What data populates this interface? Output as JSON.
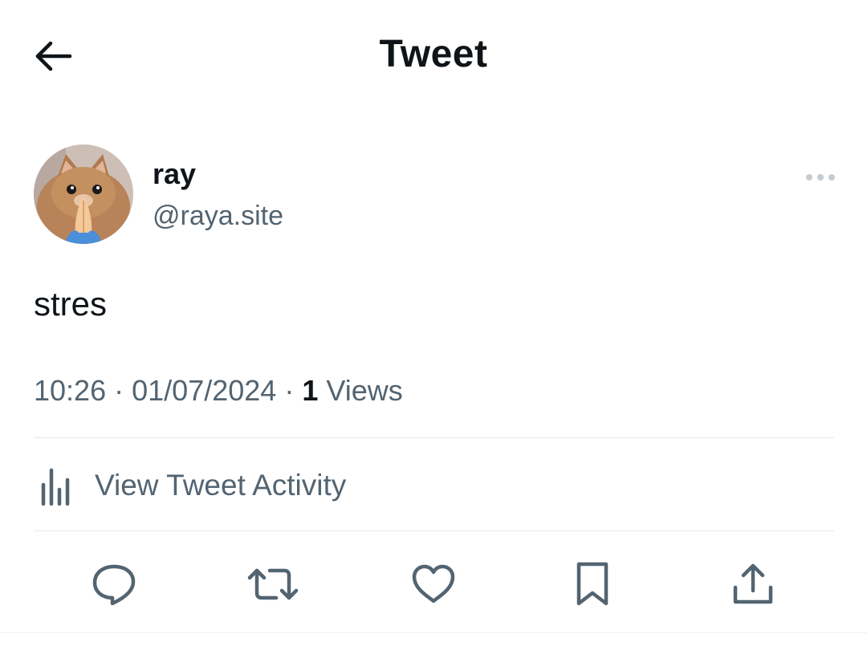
{
  "header": {
    "title": "Tweet",
    "back_icon": "arrow-left-icon"
  },
  "author": {
    "display_name": "ray",
    "handle": "@raya.site",
    "avatar_icon": "cat-praying-avatar"
  },
  "tweet": {
    "text": "stres",
    "time": "10:26",
    "date": "01/07/2024",
    "views_count": "1",
    "views_label": "Views",
    "separator": "·"
  },
  "activity": {
    "label": "View Tweet Activity",
    "icon": "bar-chart-icon"
  },
  "actions": [
    {
      "name": "reply",
      "icon": "speech-bubble-icon"
    },
    {
      "name": "retweet",
      "icon": "retweet-arrows-icon"
    },
    {
      "name": "like",
      "icon": "heart-icon"
    },
    {
      "name": "bookmark",
      "icon": "bookmark-icon"
    },
    {
      "name": "share",
      "icon": "share-upload-icon"
    }
  ],
  "colors": {
    "text_primary": "#0f1419",
    "text_secondary": "#536471",
    "divider": "#e5e8eb",
    "background": "#ffffff"
  }
}
